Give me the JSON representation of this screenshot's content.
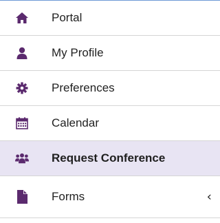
{
  "colors": {
    "icon": "#5b2a6e",
    "active_background": "#e8e4f3",
    "top_border": "#6d9ad6"
  },
  "menu": {
    "items": [
      {
        "label": "Portal",
        "icon": "home-icon",
        "active": false
      },
      {
        "label": "My Profile",
        "icon": "user-icon",
        "active": false
      },
      {
        "label": "Preferences",
        "icon": "gear-icon",
        "active": false
      },
      {
        "label": "Calendar",
        "icon": "calendar-icon",
        "active": false
      },
      {
        "label": "Request Conference",
        "icon": "users-icon",
        "active": true
      },
      {
        "label": "Forms",
        "icon": "file-icon",
        "active": false,
        "has_submenu": true,
        "submenu_indicator": "‹"
      }
    ]
  }
}
